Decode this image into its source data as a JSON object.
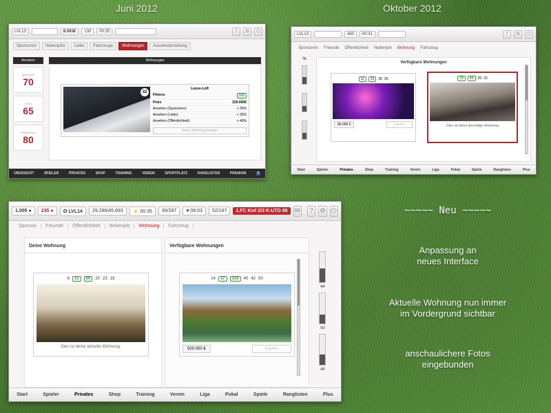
{
  "labels": {
    "june": "Juni 2012",
    "october": "Oktober 2012"
  },
  "old_ui": {
    "level": "LVL13",
    "money": "8.093€",
    "stat1": "130",
    "stat2": "00:35",
    "tabs": [
      "Sponsoren",
      "Nebenjobs",
      "Liebe",
      "Fahrzeuge",
      "Wohnungen",
      "Aussendarstellung"
    ],
    "active_tab": "Wohnungen",
    "side_title": "Ansehen",
    "side_stats": [
      {
        "label": "Sponsoren",
        "value": "70"
      },
      {
        "label": "Liebe",
        "value": "65"
      },
      {
        "label": "Öffentlichkeit",
        "value": "80"
      }
    ],
    "main_title": "Wohnungen",
    "card": {
      "badge": "32",
      "title": "Luxus-Loft",
      "fitness_label": "Fitness",
      "fitness_value": "100",
      "price_label": "Preis",
      "price_value": "150.000€",
      "rows": [
        {
          "label": "Ansehen (Sponsoren)",
          "value": "+ 35%"
        },
        {
          "label": "Ansehen (Liebe)",
          "value": "+ 35%"
        },
        {
          "label": "Ansehen (Öffentlichkeit)",
          "value": "+ 40%"
        }
      ],
      "button": "Deine Wohnung kaufen"
    },
    "bottom_nav": [
      "ÜBERSICHT",
      "SPIELER",
      "PRIVATES",
      "SHOP",
      "TRAINING",
      "VEREIN",
      "SPORTPLATZ",
      "RANGLISTEN",
      "PREMIUM"
    ],
    "active_bottom": "PRIVATES"
  },
  "oct_ui": {
    "level": "LVL13",
    "stat1": "490",
    "stat2": "00:31",
    "tabs": [
      "Sponsoren",
      "Freunde",
      "Öffentlichkeit",
      "Nebenjob",
      "Wohnung",
      "Fahrzeug"
    ],
    "active_tab": "Wohnung",
    "main_title": "Verfügbare Wohnungen",
    "card1": {
      "g1": "11",
      "g2": "36",
      "s1": "30",
      "s2": "36",
      "price": "80.000 €",
      "button": "Kaufen"
    },
    "card2": {
      "g1": "15",
      "g2": "60",
      "s1": "29",
      "s2": "23",
      "caption": "Dies ist deine derzeitige Wohnung"
    },
    "left_head": "%",
    "bottom_nav": [
      "Start",
      "Spieler",
      "Privates",
      "Shop",
      "Training",
      "Verein",
      "Liga",
      "Pokal",
      "Spiele",
      "Ranglisten",
      "Plus"
    ],
    "active_bottom": "Privates"
  },
  "new_ui": {
    "chips": {
      "coins": "1.005",
      "gems": "235",
      "level": "LVL14",
      "xp": "29.286/45.693",
      "energy_time": "00:35",
      "energy": "30/287",
      "fitness_time": "06:03",
      "fitness": "52/187"
    },
    "match": {
      "home": "1.FC Kiel",
      "score": "2/3",
      "away": "K-UTD",
      "badge": "00"
    },
    "tabs": [
      "Sponsor",
      "Freunde",
      "Öffentlichkeit",
      "Nebenjob",
      "Wohnung",
      "Fahrzeug"
    ],
    "active_tab": "Wohnung",
    "left_panel": {
      "title": "Deine Wohnung",
      "badge": "8",
      "g1": "15",
      "g2": "60",
      "s1": "20",
      "s2": "23",
      "s3": "23",
      "caption": "Dies ist deine aktuelle Wohnung."
    },
    "right_panel": {
      "title": "Verfügbare Wohnungen",
      "badge": "14",
      "g1": "37",
      "g2": "150",
      "s1": "40",
      "s2": "42",
      "s3": "50",
      "price": "500.000 €",
      "button": "Kaufen"
    },
    "gauges": [
      {
        "label": "44",
        "level": 0.45
      },
      {
        "label": "43",
        "level": 0.3
      },
      {
        "label": "44",
        "level": 0.35
      }
    ],
    "bottom_nav": [
      "Start",
      "Spieler",
      "Privates",
      "Shop",
      "Training",
      "Verein",
      "Liga",
      "Pokal",
      "Spiele",
      "Ranglisten",
      "Plus"
    ],
    "active_bottom": "Privates"
  },
  "blurb": {
    "title": "~~~~~ Neu ~~~~~",
    "p1_line1": "Anpassung an",
    "p1_line2": "neues Interface",
    "p2_line1": "Aktuelle Wohnung nun immer",
    "p2_line2": "im Vordergrund sichtbar",
    "p3_line1": "anschaulichere Fotos",
    "p3_line2": "eingebunden"
  }
}
